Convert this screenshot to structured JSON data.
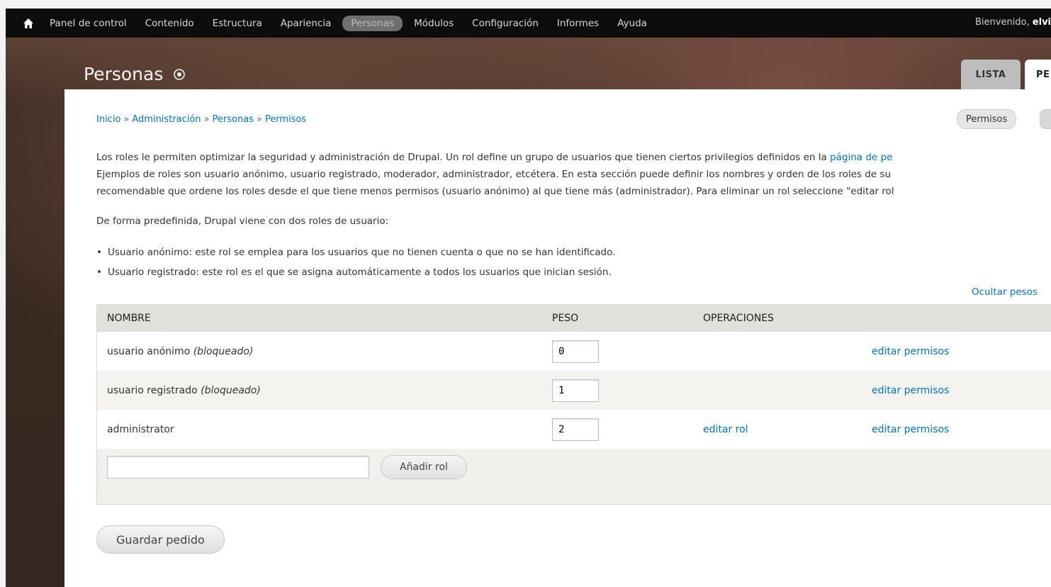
{
  "toolbar": {
    "items": [
      {
        "label": "Panel de control"
      },
      {
        "label": "Contenido"
      },
      {
        "label": "Estructura"
      },
      {
        "label": "Apariencia"
      },
      {
        "label": "Personas"
      },
      {
        "label": "Módulos"
      },
      {
        "label": "Configuración"
      },
      {
        "label": "Informes"
      },
      {
        "label": "Ayuda"
      }
    ],
    "welcome_prefix": "Bienvenido,",
    "welcome_user": "elvi"
  },
  "header": {
    "title": "Personas",
    "tabs": [
      {
        "label": "LISTA"
      },
      {
        "label": "PE"
      }
    ]
  },
  "breadcrumb": {
    "items": [
      "Inicio",
      "Administración",
      "Personas",
      "Permisos"
    ],
    "separator": "»"
  },
  "shortcut": {
    "label": "Permisos"
  },
  "description": {
    "line1_text": "Los roles le permiten optimizar la seguridad y administración de Drupal. Un rol define un grupo de usuarios que tienen ciertos privilegios definidos en la ",
    "line1_link": "página de pe",
    "line2": "Ejemplos de roles son usuario anónimo, usuario registrado, moderador, administrador, etcétera. En esta sección puede definir los nombres y orden de los roles de su",
    "line3": "recomendable que ordene los roles desde el que tiene menos permisos (usuario anónimo) al que tiene más (administrador). Para eliminar un rol seleccione \"editar rol"
  },
  "intro": "De forma predefinida, Drupal viene con dos roles de usuario:",
  "bullets": [
    "Usuario anónimo: este rol se emplea para los usuarios que no tienen cuenta o que no se han identificado.",
    "Usuario registrado: este rol es el que se asigna automáticamente a todos los usuarios que inician sesión."
  ],
  "hide_weights": "Ocultar pesos",
  "table": {
    "headers": {
      "name": "NOMBRE",
      "weight": "PESO",
      "operations": "OPERACIONES"
    },
    "rows": [
      {
        "name": "usuario anónimo",
        "locked": "(bloqueado)",
        "weight": "0",
        "edit_role": "",
        "edit_perms": "editar permisos"
      },
      {
        "name": "usuario registrado",
        "locked": "(bloqueado)",
        "weight": "1",
        "edit_role": "",
        "edit_perms": "editar permisos"
      },
      {
        "name": "administrator",
        "locked": "",
        "weight": "2",
        "edit_role": "editar rol",
        "edit_perms": "editar permisos"
      }
    ],
    "add_role_value": "",
    "add_role_button": "Añadir rol"
  },
  "save_button": "Guardar pedido",
  "colors": {
    "link": "#0074bd",
    "toolbar_bg": "#0d0d0d",
    "active_pill": "#6f6f6f"
  }
}
